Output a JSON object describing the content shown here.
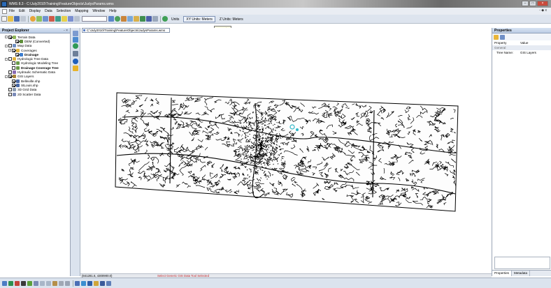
{
  "window": {
    "title": "WMS 8.3 - C:\\July2010\\Training\\FeatureObjects\\JudysParams.wms"
  },
  "menu": {
    "items": [
      "File",
      "Edit",
      "Display",
      "Data",
      "Selection",
      "Mapping",
      "Window",
      "Help"
    ],
    "right": "- ◆ x"
  },
  "toolbar": {
    "units": "Units",
    "xy_units": "XY Units: Meters",
    "z_units": "Z Units: Meters",
    "tooltip": "XY Units"
  },
  "project_explorer": {
    "title": "Project Explorer",
    "controls": "- ×",
    "tree": [
      {
        "label": "Terrain Data",
        "indent": 1,
        "toggle": true,
        "checked": true,
        "icon": "terrain",
        "bold": false
      },
      {
        "label": "DEM (Converted)",
        "indent": 3,
        "toggle": false,
        "checked": true,
        "icon": "dem",
        "bold": false
      },
      {
        "label": "Map Data",
        "indent": 1,
        "toggle": true,
        "checked": false,
        "icon": "map",
        "bold": false
      },
      {
        "label": "Coverages",
        "indent": 2,
        "toggle": true,
        "checked": true,
        "icon": "folder",
        "bold": false
      },
      {
        "label": "Drainage",
        "indent": 3,
        "toggle": false,
        "checked": true,
        "icon": "drainage",
        "bold": true
      },
      {
        "label": "Hydrologic Tree Data",
        "indent": 1,
        "toggle": true,
        "checked": false,
        "icon": "folder",
        "bold": false
      },
      {
        "label": "Hydrologic Modeling Tree",
        "indent": 2,
        "toggle": false,
        "checked": false,
        "icon": "tree",
        "bold": false
      },
      {
        "label": "Drainage Coverage Tree",
        "indent": 2,
        "toggle": false,
        "checked": false,
        "icon": "tree",
        "bold": true
      },
      {
        "label": "Hydraulic Schematic Data",
        "indent": 1,
        "toggle": false,
        "checked": false,
        "icon": "schem",
        "bold": false
      },
      {
        "label": "GIS Layers",
        "indent": 1,
        "toggle": true,
        "checked": true,
        "icon": "gis",
        "bold": false
      },
      {
        "label": "Belleville.shp",
        "indent": 2,
        "toggle": false,
        "checked": true,
        "icon": "shp",
        "bold": false
      },
      {
        "label": "StLouis.shp",
        "indent": 2,
        "toggle": false,
        "checked": true,
        "icon": "shp",
        "bold": false
      },
      {
        "label": "3D Grid Data",
        "indent": 1,
        "toggle": false,
        "checked": false,
        "icon": "grid",
        "bold": false
      },
      {
        "label": "2D Scatter Data",
        "indent": 1,
        "toggle": false,
        "checked": false,
        "icon": "scatter",
        "bold": false
      }
    ]
  },
  "address": {
    "path": "C:\\July2010\\Training\\FeatureObjects\\JudysParams.wms"
  },
  "properties": {
    "title": "Properties",
    "col_property": "Property",
    "col_value": "Value",
    "group": "General",
    "rows": [
      {
        "key": "Tree Name:",
        "value": "GIS Layers"
      }
    ],
    "tabs": [
      "Properties",
      "Metadata"
    ]
  },
  "status": {
    "coords": "(841281.6, 4300900.0)",
    "message": "Select Generic GIS Data Tool Selected"
  },
  "colors": {
    "accent": "#2a6ab8",
    "status_message": "#c0282b"
  }
}
